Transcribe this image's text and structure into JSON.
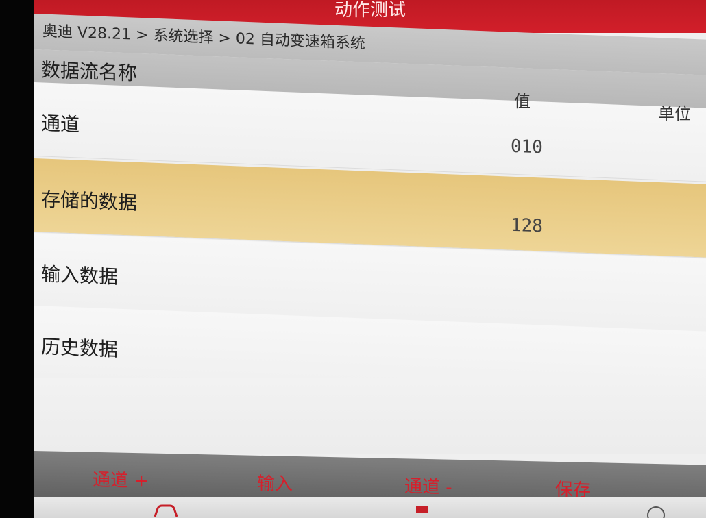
{
  "title": "动作测试",
  "breadcrumb": "奥迪 V28.21 > 系统选择 > 02 自动变速箱系统",
  "columns": {
    "name": "数据流名称",
    "value": "值",
    "unit": "单位"
  },
  "rows": [
    {
      "name": "通道",
      "value": "010",
      "selected": false
    },
    {
      "name": "存储的数据",
      "value": "128",
      "selected": true
    },
    {
      "name": "输入数据",
      "value": "",
      "selected": false
    },
    {
      "name": "历史数据",
      "value": "",
      "selected": false
    }
  ],
  "toolbar": {
    "channel_plus": "通道 +",
    "input": "输入",
    "channel_minus": "通道 -",
    "save": "保存"
  },
  "nav_icons": [
    "car-icon",
    "red-home-icon",
    "info-icon"
  ],
  "colors": {
    "title_bar": "#d21f2a",
    "selected_row": "#ebcf8b",
    "toolbar_text": "#d61f2b"
  }
}
